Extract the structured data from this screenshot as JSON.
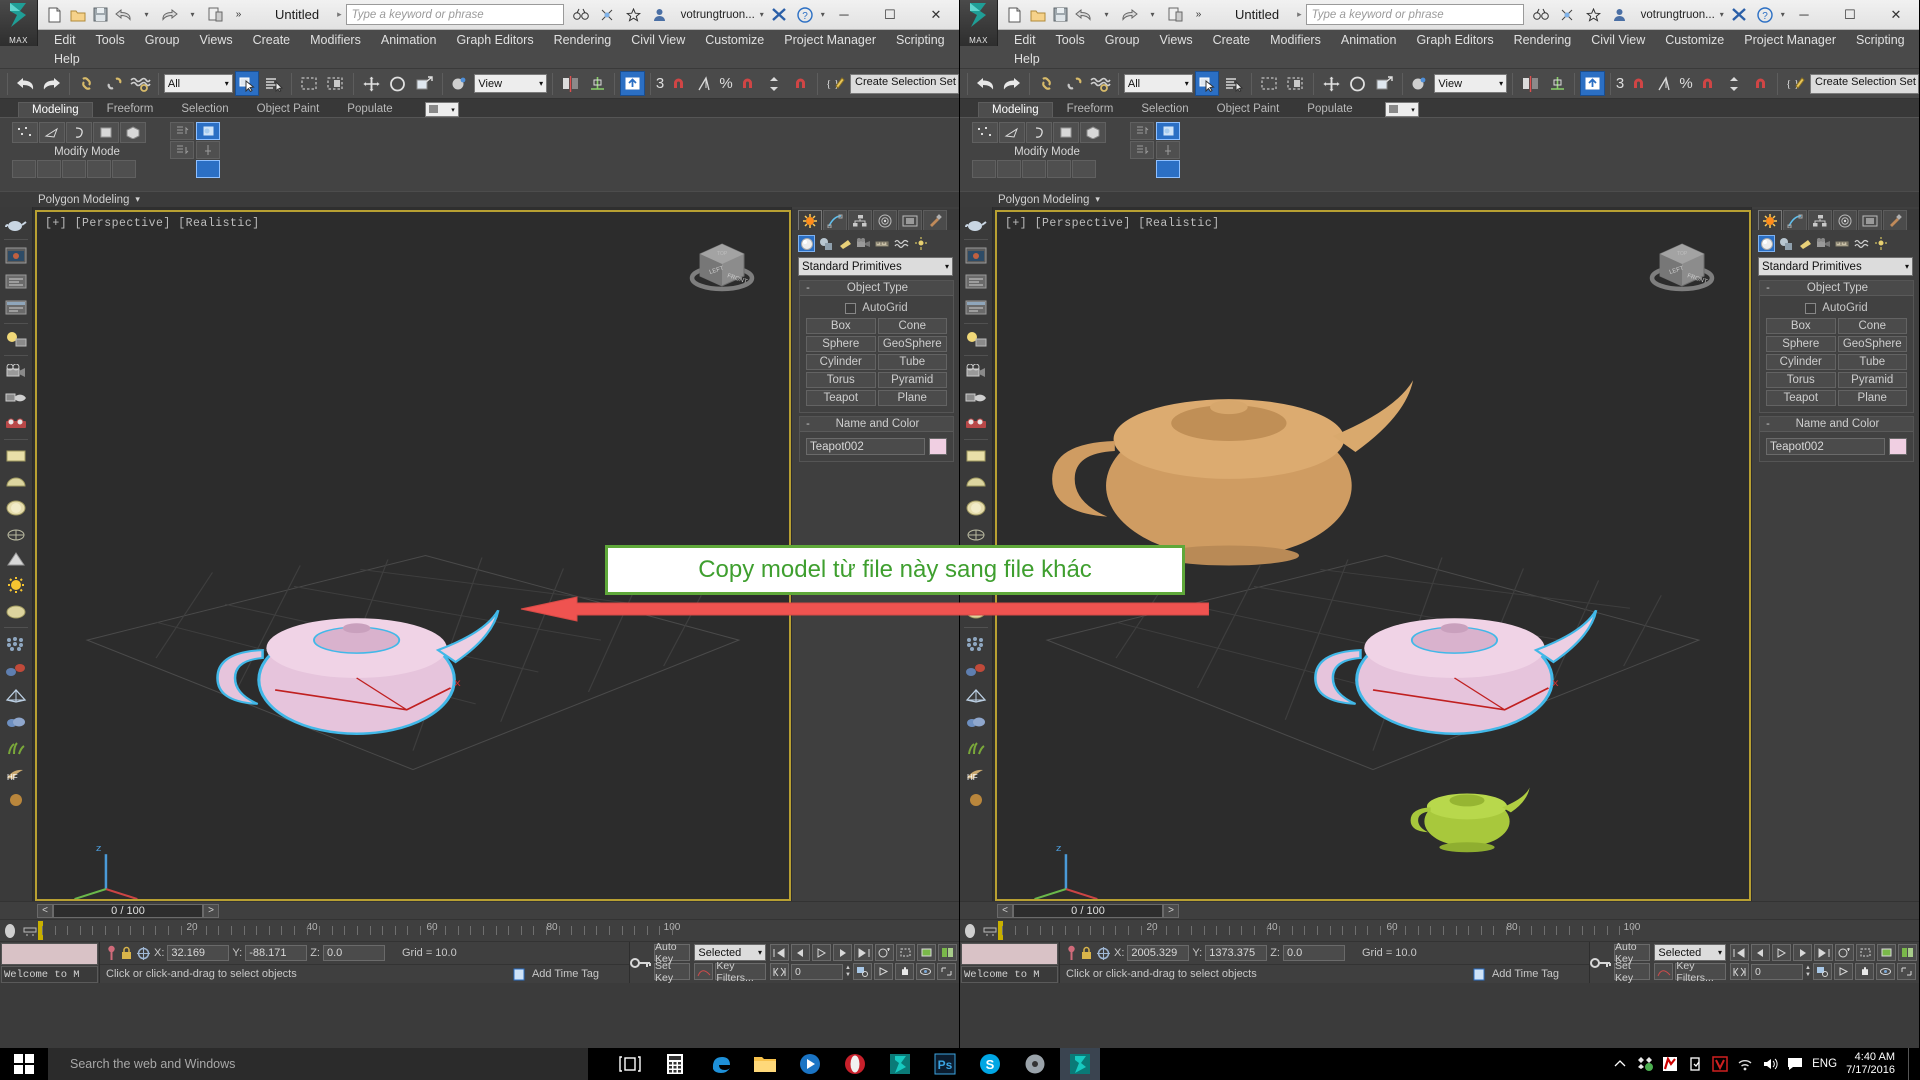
{
  "app": {
    "product": "MAX",
    "doc_title": "Untitled",
    "search_placeholder": "Type a keyword or phrase",
    "user": "votrungtruon...",
    "menu": [
      "Edit",
      "Tools",
      "Group",
      "Views",
      "Create",
      "Modifiers",
      "Animation",
      "Graph Editors",
      "Rendering",
      "Civil View",
      "Customize",
      "Project Manager",
      "Scripting"
    ],
    "menu_row2": [
      "Help"
    ],
    "window_buttons": {
      "minimize": "─",
      "maximize": "☐",
      "close": "✕"
    }
  },
  "toolbar": {
    "selection_filter": "All",
    "reference_coord": "View",
    "named_set_placeholder": "Create Selection Set",
    "icons": [
      "undo-icon",
      "redo-icon",
      "select-link-icon",
      "unlink-icon",
      "bind-space-warp-icon",
      "select-object-icon",
      "select-by-name-icon",
      "rect-select-region-icon",
      "window-crossing-icon",
      "select-and-move-icon",
      "select-and-rotate-icon",
      "select-and-scale-icon",
      "use-center-icon",
      "mirror-icon",
      "align-icon",
      "snap-toggle-icon",
      "angle-snap-icon",
      "percent-snap-icon",
      "spinner-snap-icon",
      "edit-named-sets-icon"
    ],
    "snap_labels": [
      "3",
      "%"
    ]
  },
  "ribbon": {
    "tabs": [
      "Modeling",
      "Freeform",
      "Selection",
      "Object Paint",
      "Populate"
    ],
    "active_tab": "Modeling",
    "mode_label": "Modify Mode",
    "footer_label": "Polygon Modeling",
    "footer_caret": "▾"
  },
  "viewport": {
    "label": "[+] [Perspective] [Realistic]",
    "viewcube_faces": [
      "TOP",
      "LEFT",
      "FRONT"
    ]
  },
  "command_panel": {
    "tabs": [
      "create-tab",
      "modify-tab",
      "hierarchy-tab",
      "motion-tab",
      "display-tab",
      "utilities-tab"
    ],
    "active_tab": "create-tab",
    "sub_icons": [
      "geometry-icon",
      "shapes-icon",
      "lights-icon",
      "cameras-icon",
      "helpers-icon",
      "space-warps-icon",
      "systems-icon"
    ],
    "category": "Standard Primitives",
    "object_type": {
      "title": "Object Type",
      "autogrid_label": "AutoGrid",
      "autogrid_checked": false,
      "buttons": [
        "Box",
        "Cone",
        "Sphere",
        "GeoSphere",
        "Cylinder",
        "Tube",
        "Torus",
        "Pyramid",
        "Teapot",
        "Plane"
      ]
    },
    "name_and_color": {
      "title": "Name and Color",
      "name": "Teapot002",
      "color": "#f0cfe2"
    },
    "collapse_glyph": "-"
  },
  "timeline": {
    "prev_btn": "<",
    "next_btn": ">",
    "frame_display": "0 / 100",
    "ticks": [
      "20",
      "40",
      "60",
      "80",
      "100"
    ]
  },
  "status": {
    "prompt_line": "Welcome to M",
    "hint": "Click or click-and-drag to select objects",
    "add_time_tag": "Add Time Tag",
    "coords": {
      "left_window": {
        "x_label": "X:",
        "x": "32.169",
        "y_label": "Y:",
        "y": "-88.171",
        "z_label": "Z:",
        "z": "0.0",
        "grid": "Grid = 10.0"
      },
      "right_window": {
        "x_label": "X:",
        "x": "2005.329",
        "y_label": "Y:",
        "y": "1373.375",
        "z_label": "Z:",
        "z": "0.0",
        "grid": "Grid = 10.0"
      }
    },
    "auto_key": "Auto Key",
    "set_key": "Set Key",
    "key_mode": "Selected",
    "key_filters": "Key Filters...",
    "key_field": "0"
  },
  "annotation": {
    "text": "Copy model từ file này sang file khác",
    "text_color": "#3f9f2f",
    "border_color": "#5fa83a",
    "arrow_color": "#ef5350",
    "arrow_direction": "left"
  },
  "taskbar": {
    "search_placeholder": "Search the web and Windows",
    "apps": [
      "task-view-icon",
      "calculator-icon",
      "edge-icon",
      "file-explorer-icon",
      "media-player-icon",
      "opera-icon",
      "3dsmax-icon",
      "photoshop-icon",
      "skype-icon",
      "disc-icon",
      "3dsmax-active-icon"
    ],
    "tray": [
      "show-hidden-icon",
      "dropbox-icon",
      "kaspersky-icon",
      "usb-eject-icon",
      "v-icon",
      "wifi-icon",
      "volume-icon",
      "action-center-icon"
    ],
    "language": "ENG",
    "time": "4:40 AM",
    "date": "7/17/2016"
  }
}
